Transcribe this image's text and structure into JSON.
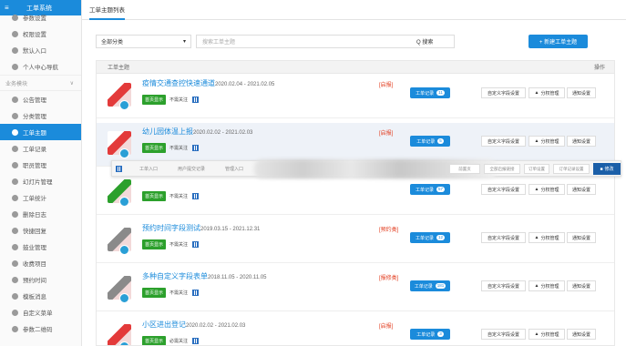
{
  "sidebar": {
    "app_title": "工单系统",
    "items_top": [
      {
        "label": "参数设置"
      },
      {
        "label": "权限设置"
      },
      {
        "label": "默认入口"
      },
      {
        "label": "个人中心导航"
      }
    ],
    "group_label": "业务模块",
    "items": [
      {
        "label": "公告管理",
        "active": false
      },
      {
        "label": "分类管理",
        "active": false
      },
      {
        "label": "工单主题",
        "active": true
      },
      {
        "label": "工单记录",
        "active": false
      },
      {
        "label": "职员管理",
        "active": false
      },
      {
        "label": "幻灯片管理",
        "active": false
      },
      {
        "label": "工单统计",
        "active": false
      },
      {
        "label": "删除日志",
        "active": false
      },
      {
        "label": "快捷回复",
        "active": false
      },
      {
        "label": "鼓业管理",
        "active": false
      },
      {
        "label": "收费项目",
        "active": false
      },
      {
        "label": "预约时间",
        "active": false
      },
      {
        "label": "模板消息",
        "active": false
      },
      {
        "label": "自定义菜单",
        "active": false
      },
      {
        "label": "参数二维码",
        "active": false
      }
    ]
  },
  "tab": {
    "label": "工单主题列表"
  },
  "filter": {
    "category_value": "全部分类",
    "search_placeholder": "搜索工单主题",
    "search_label": "Q 搜索",
    "new_label": "+ 新建工单主题"
  },
  "table": {
    "col_title": "工单主题",
    "col_ops": "操作",
    "work_label": "工单记录",
    "op_custom": "自定义字段设置",
    "op_perm": "分权管理",
    "op_notify": "通知设置",
    "rows": [
      {
        "title": "疫情交通查控快速通道",
        "date": "2020.02.04 - 2021.02.05",
        "status": "[启报]",
        "count": "11",
        "tag1": "首页显示",
        "tag2": "不需关注",
        "thumb": "#e33a3a"
      },
      {
        "title": "幼儿园体温上报",
        "date": "2020.02.02 - 2021.02.03",
        "status": "[启报]",
        "count": "5",
        "tag1": "首页显示",
        "tag2": "不需关注",
        "thumb": "#e33a3a"
      },
      {
        "title": "",
        "date": "",
        "status": "",
        "count": "57",
        "tag1": "首页显示",
        "tag2": "不需关注",
        "thumb": "#2ca02c"
      },
      {
        "title": "预约时间字段测试",
        "date": "2019.03.15 - 2021.12.31",
        "status": "[预约类]",
        "count": "12",
        "tag1": "首页显示",
        "tag2": "不需关注",
        "thumb": "#8a8a8a"
      },
      {
        "title": "多种自定义字段表单",
        "date": "2018.11.05 - 2020.11.05",
        "status": "[报修类]",
        "count": "181",
        "tag1": "首页显示",
        "tag2": "不需关注",
        "thumb": "#8a8a8a"
      },
      {
        "title": "小区进出登记",
        "date": "2020.02.02 - 2021.02.03",
        "status": "[启报]",
        "count": "3",
        "tag1": "首页显示",
        "tag2": "必需关注",
        "thumb": "#e33a3a"
      }
    ]
  },
  "popup": {
    "tab_entry": "工单入口",
    "tab_submit": "用户提交记录",
    "tab_manage": "管理入口",
    "btn_first": "前置页",
    "btn_all": "全部启报链接",
    "btn_order": "订单设置",
    "btn_export": "订单记录设置",
    "btn_edit": "修改"
  },
  "colors": {
    "accent": "#1b8bdb",
    "green": "#2ca02c",
    "red": "#e23c1e"
  }
}
